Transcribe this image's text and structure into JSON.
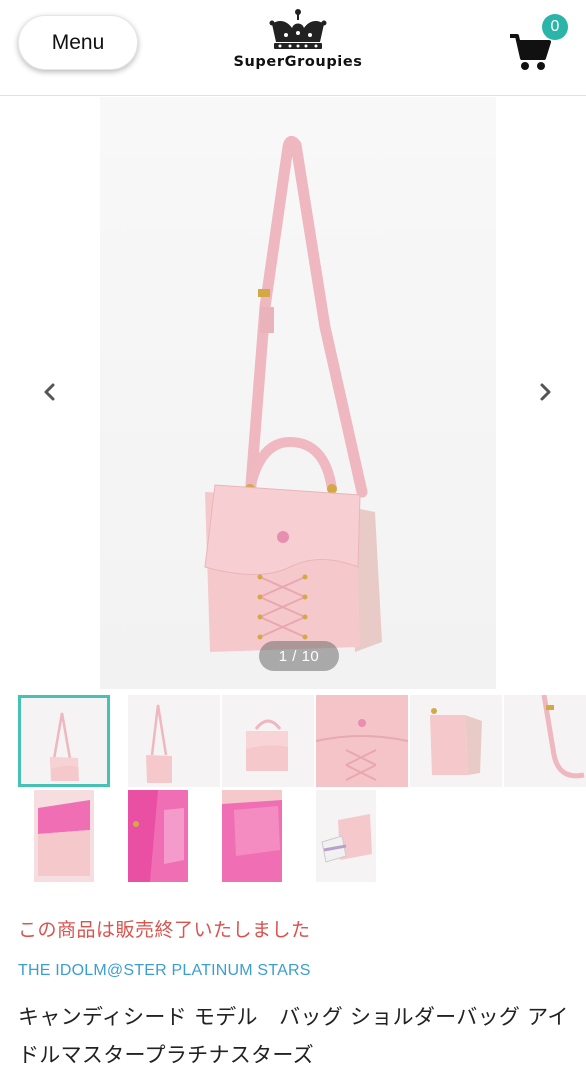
{
  "header": {
    "menu_label": "Menu",
    "logo_text": "SuperGroupies",
    "logo_icon": "crown-icon",
    "cart_icon": "cart-icon",
    "cart_count": "0"
  },
  "gallery": {
    "counter": "1 / 10",
    "prev_icon": "chevron-left-icon",
    "next_icon": "chevron-right-icon"
  },
  "thumbnails": {
    "count": 10,
    "active_index": 0
  },
  "product": {
    "status": "この商品は販売終了いたしました",
    "series": "THE IDOLM@STER PLATINUM STARS",
    "title": "キャンディシード モデル　バッグ ショルダーバッグ アイドルマスタープラチナスターズ"
  },
  "colors": {
    "accent": "#45c1b5",
    "badge": "#2bb5a8",
    "status": "#d9534f",
    "series": "#3a9fd0",
    "bag_pink": "#f4c4c8"
  }
}
